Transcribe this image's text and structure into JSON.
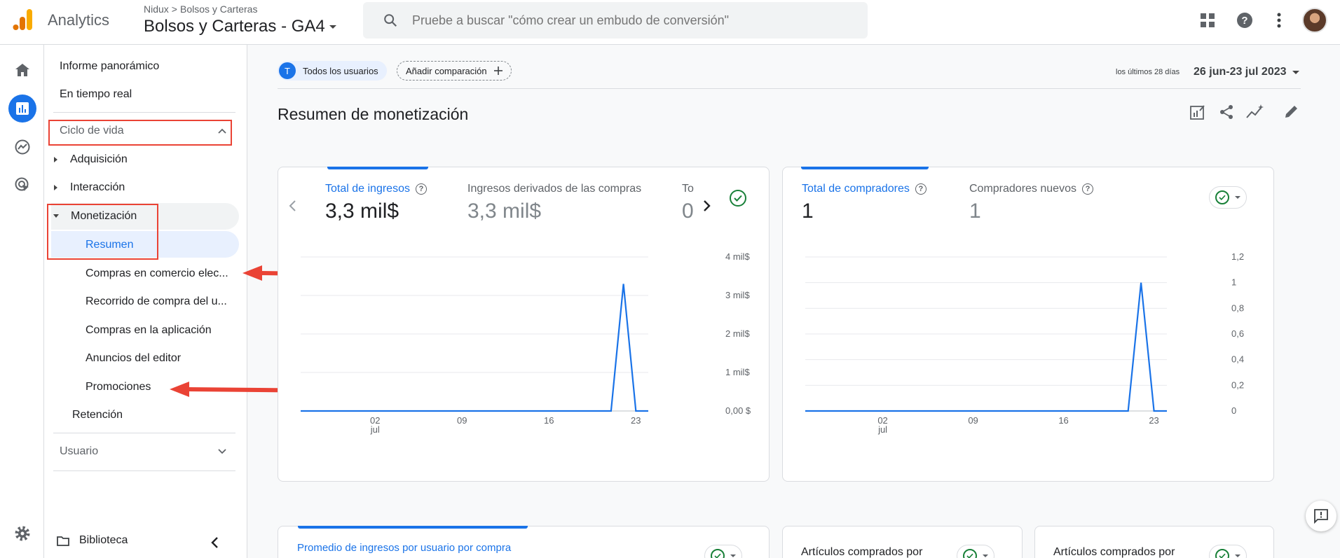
{
  "header": {
    "app_name": "Analytics",
    "breadcrumb": [
      "Nidux",
      "Bolsos y Carteras"
    ],
    "property_name": "Bolsos y Carteras - GA4",
    "search_placeholder": "Pruebe a buscar \"cómo crear un embudo de conversión\"",
    "icons": [
      "apps-grid-icon",
      "help-icon",
      "more-vert-icon",
      "avatar"
    ]
  },
  "rail": {
    "icons": [
      "home-icon",
      "reports-icon",
      "explore-icon",
      "advertising-icon",
      "settings-icon"
    ],
    "active": "reports-icon"
  },
  "nav": {
    "top_items": [
      "Informe panorámico",
      "En tiempo real"
    ],
    "section_lifecycle": "Ciclo de vida",
    "lifecycle_items": {
      "adquisicion": "Adquisición",
      "interaccion": "Interacción",
      "monetizacion": "Monetización",
      "resumen": "Resumen",
      "compras_comercio": "Compras en comercio elec...",
      "recorrido": "Recorrido de compra del u...",
      "compras_app": "Compras en la aplicación",
      "anuncios": "Anuncios del editor",
      "promociones": "Promociones",
      "retencion": "Retención"
    },
    "section_user": "Usuario",
    "library": "Biblioteca"
  },
  "main": {
    "segment_chip": {
      "initial": "T",
      "label": "Todos los usuarios"
    },
    "add_comparison": "Añadir comparación",
    "date_prefix": "los últimos 28 días",
    "date_range": "26 jun-23 jul 2023",
    "title": "Resumen de monetización",
    "card1": {
      "metrics": [
        {
          "label": "Total de ingresos",
          "value": "3,3 mil$"
        },
        {
          "label": "Ingresos derivados de las compras",
          "value": "3,3 mil$"
        },
        {
          "label": "To",
          "value": "0"
        }
      ]
    },
    "card2": {
      "metrics": [
        {
          "label": "Total de compradores",
          "value": "1"
        },
        {
          "label": "Compradores nuevos",
          "value": "1"
        }
      ]
    },
    "bottom_cards": [
      "Promedio de ingresos por usuario por compra",
      "Artículos comprados por",
      "Artículos comprados por"
    ]
  },
  "chart_data": [
    {
      "type": "line",
      "x_tick_labels": [
        "02",
        "09",
        "16",
        "23"
      ],
      "x_month_label": "jul",
      "y_tick_labels": [
        "0,00 $",
        "1 mil$",
        "2 mil$",
        "3 mil$",
        "4 mil$"
      ],
      "ylim": [
        0,
        4000
      ],
      "series": [
        {
          "values": [
            0,
            0,
            0,
            0,
            0,
            0,
            0,
            0,
            0,
            0,
            0,
            0,
            0,
            0,
            0,
            0,
            0,
            0,
            0,
            0,
            0,
            0,
            0,
            0,
            0,
            0,
            3300,
            0,
            0
          ]
        }
      ],
      "color": "#1a73e8"
    },
    {
      "type": "line",
      "x_tick_labels": [
        "02",
        "09",
        "16",
        "23"
      ],
      "x_month_label": "jul",
      "y_tick_labels": [
        "0",
        "0,2",
        "0,4",
        "0,6",
        "0,8",
        "1",
        "1,2"
      ],
      "ylim": [
        0,
        1.2
      ],
      "series": [
        {
          "values": [
            0,
            0,
            0,
            0,
            0,
            0,
            0,
            0,
            0,
            0,
            0,
            0,
            0,
            0,
            0,
            0,
            0,
            0,
            0,
            0,
            0,
            0,
            0,
            0,
            0,
            0,
            1,
            0,
            0
          ]
        }
      ],
      "color": "#1a73e8"
    }
  ],
  "colors": {
    "accent": "#1a73e8",
    "highlight": "#ea4335",
    "ok": "#188038"
  }
}
